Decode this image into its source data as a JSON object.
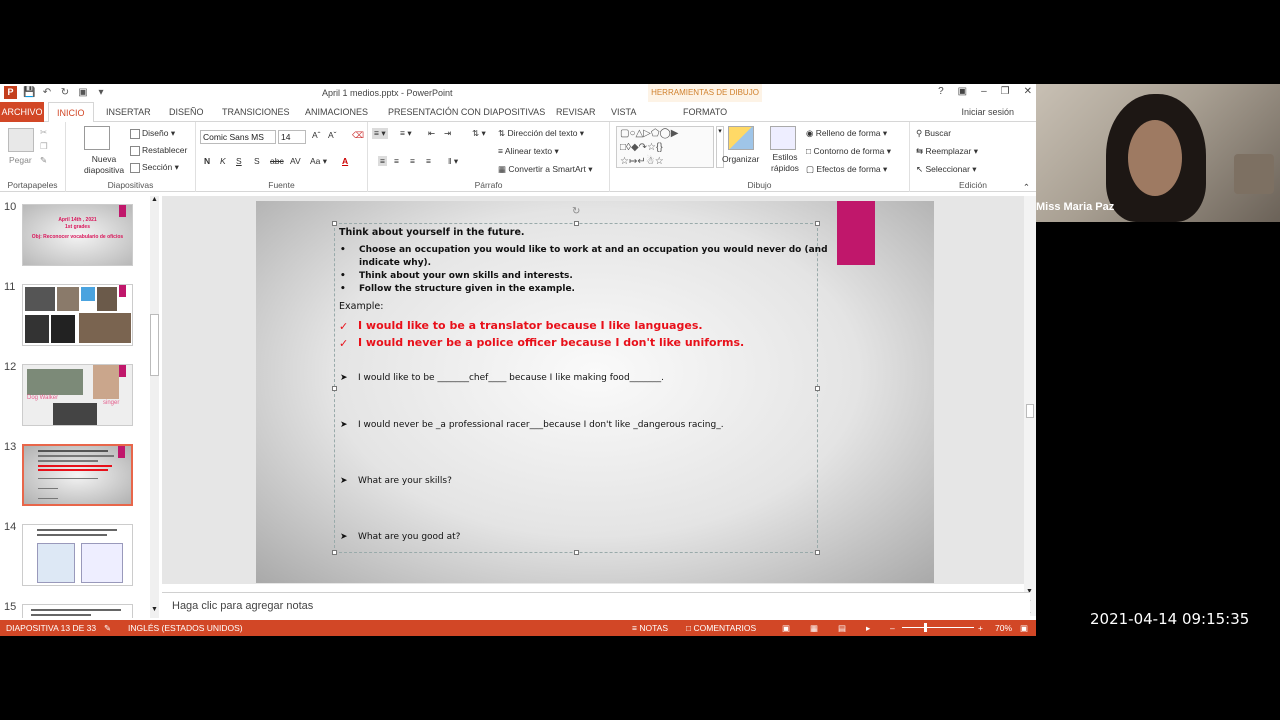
{
  "window": {
    "title": "April 1 medios.pptx - PowerPoint",
    "contextual_tab": "HERRAMIENTAS DE DIBUJO",
    "signin": "Iniciar sesión"
  },
  "menu": {
    "tabs": [
      "ARCHIVO",
      "INICIO",
      "INSERTAR",
      "DISEÑO",
      "TRANSICIONES",
      "ANIMACIONES",
      "PRESENTACIÓN CON DIAPOSITIVAS",
      "REVISAR",
      "VISTA",
      "FORMATO"
    ]
  },
  "ribbon": {
    "portapapeles": {
      "label": "Portapapeles",
      "paste": "Pegar"
    },
    "diapositivas": {
      "label": "Diapositivas",
      "new": "Nueva diapositiva",
      "layout": "Diseño",
      "reset": "Restablecer",
      "section": "Sección"
    },
    "fuente": {
      "label": "Fuente",
      "font": "Comic Sans MS",
      "size": "14"
    },
    "parrafo": {
      "label": "Párrafo",
      "direction": "Dirección del texto",
      "align": "Alinear texto",
      "smartart": "Convertir a SmartArt"
    },
    "dibujo": {
      "label": "Dibujo",
      "arrange": "Organizar",
      "styles": "Estilos rápidos",
      "fill": "Relleno de forma",
      "outline": "Contorno de forma",
      "effects": "Efectos de forma"
    },
    "edicion": {
      "label": "Edición",
      "find": "Buscar",
      "replace": "Reemplazar",
      "select": "Seleccionar"
    }
  },
  "thumbnails": [
    {
      "num": "10",
      "title": "April 14th , 2021",
      "sub": "1st grades",
      "obj": "Obj: Reconocer vocabulario de oficios"
    },
    {
      "num": "11"
    },
    {
      "num": "12",
      "caption1": "Dog Walker",
      "caption2": "singer"
    },
    {
      "num": "13"
    },
    {
      "num": "14"
    },
    {
      "num": "15"
    }
  ],
  "slide": {
    "heading": "Think about yourself   in the future.",
    "bullets": [
      "Choose an occupation you would like to work at and an occupation you would never do (and",
      "indicate why).",
      "Think about your own skills and interests.",
      "Follow the structure given in the example."
    ],
    "example_label": "Example:",
    "example1": "I would like to be a translator because I like languages.",
    "example2": "I would never be a police officer because I don't like uniforms.",
    "q1": "I would like to be _______chef____  because  I like  making food_______.",
    "q2": "I would never be _a professional racer___because I don't like    _dangerous racing_.",
    "q3": "What are your skills?",
    "q4": "What are you good at?"
  },
  "notes": {
    "placeholder": "Haga clic para agregar notas"
  },
  "status": {
    "slide": "DIAPOSITIVA 13 DE 33",
    "language": "INGLÉS (ESTADOS UNIDOS)",
    "notes": "NOTAS",
    "comments": "COMENTARIOS",
    "zoom": "70%"
  },
  "webcam": {
    "name": "Miss Maria Paz"
  },
  "clock": "2021-04-14 09:15:35",
  "colors": {
    "accent": "#d24726",
    "slide_pink": "#c0176b",
    "example_red": "#e8101a"
  }
}
